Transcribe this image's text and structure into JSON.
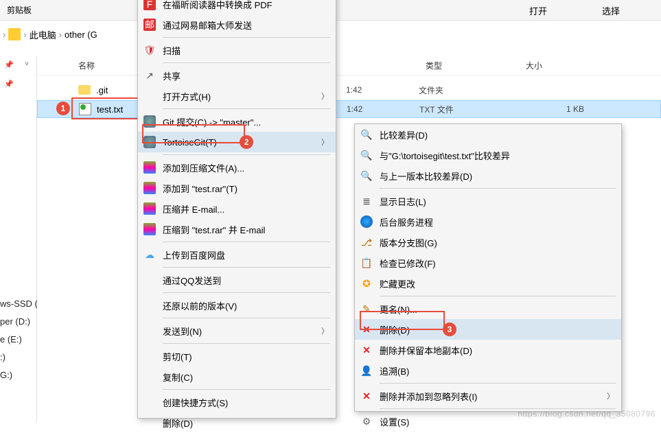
{
  "ribbon": {
    "clipboard": "剪贴板",
    "open": "打开",
    "select": "选择"
  },
  "breadcrumb": {
    "pc": "此电脑",
    "drive": "other (G"
  },
  "columns": {
    "name": "名称",
    "type": "类型",
    "size": "大小"
  },
  "files": {
    "row1": {
      "name": ".git",
      "time": "1:42",
      "type": "文件夹"
    },
    "row2": {
      "name": "test.txt",
      "time": "1:42",
      "type": "TXT 文件",
      "size": "1 KB"
    }
  },
  "sidebar": {
    "ws": "ws-SSD (",
    "per": "per (D:)",
    "e": "e (E:)",
    "colon": ":)",
    "g": "G:)"
  },
  "menu1": {
    "pdf": "在福昕阅读器中转换成 PDF",
    "netease": "通过网易邮箱大师发送",
    "scan": "扫描",
    "share": "共享",
    "openwith": "打开方式(H)",
    "gitcommit": "Git 提交(C) -> \"master\"...",
    "tortoise": "TortoiseGit(T)",
    "addarchive": "添加到压缩文件(A)...",
    "addtest": "添加到 \"test.rar\"(T)",
    "zipemail": "压缩并 E-mail...",
    "ziptest": "压缩到 \"test.rar\" 并 E-mail",
    "baidu": "上传到百度网盘",
    "qq": "通过QQ发送到",
    "restore": "还原以前的版本(V)",
    "sendto": "发送到(N)",
    "cut": "剪切(T)",
    "copy": "复制(C)",
    "shortcut": "创建快捷方式(S)",
    "delete": "删除(D)"
  },
  "menu2": {
    "diff": "比较差异(D)",
    "diffpath": "与\"G:\\tortoisegit\\test.txt\"比较差异",
    "diffprev": "与上一版本比较差异(D)",
    "showlog": "显示日志(L)",
    "daemon": "后台服务进程",
    "revgraph": "版本分支图(G)",
    "checkmods": "检查已修改(F)",
    "stash": "贮藏更改",
    "rename": "更名(N)...",
    "delete": "删除(D)",
    "deletekeep": "删除并保留本地副本(D)",
    "blame": "追溯(B)",
    "addignore": "删除并添加到忽略列表(I)",
    "settings": "设置(S)"
  },
  "badges": {
    "b1": "1",
    "b2": "2",
    "b3": "3"
  },
  "watermark": "https://blog.csdn.net/qq_35080796"
}
